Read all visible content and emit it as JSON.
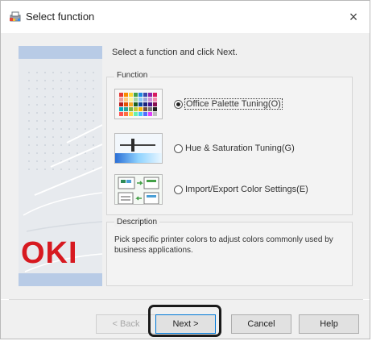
{
  "window": {
    "title": "Select function",
    "close_glyph": "×"
  },
  "branding": {
    "logo_text": "OKI",
    "logo_color": "#d71920"
  },
  "instruction": "Select a function and click Next.",
  "function_group": {
    "label": "Function",
    "options": [
      {
        "label": "Office Palette Tuning(O)",
        "selected": true,
        "icon": "palette-grid-icon"
      },
      {
        "label": "Hue & Saturation Tuning(G)",
        "selected": false,
        "icon": "slider-icon"
      },
      {
        "label": "Import/Export Color Settings(E)",
        "selected": false,
        "icon": "import-export-icon"
      }
    ]
  },
  "description": {
    "label": "Description",
    "text": "Pick specific printer colors to adjust colors commonly used by business applications."
  },
  "buttons": {
    "back": "< Back",
    "next": "Next >",
    "cancel": "Cancel",
    "help": "Help"
  },
  "colors": {
    "accent": "#0078d7",
    "side_band": "#b8cbe6"
  }
}
